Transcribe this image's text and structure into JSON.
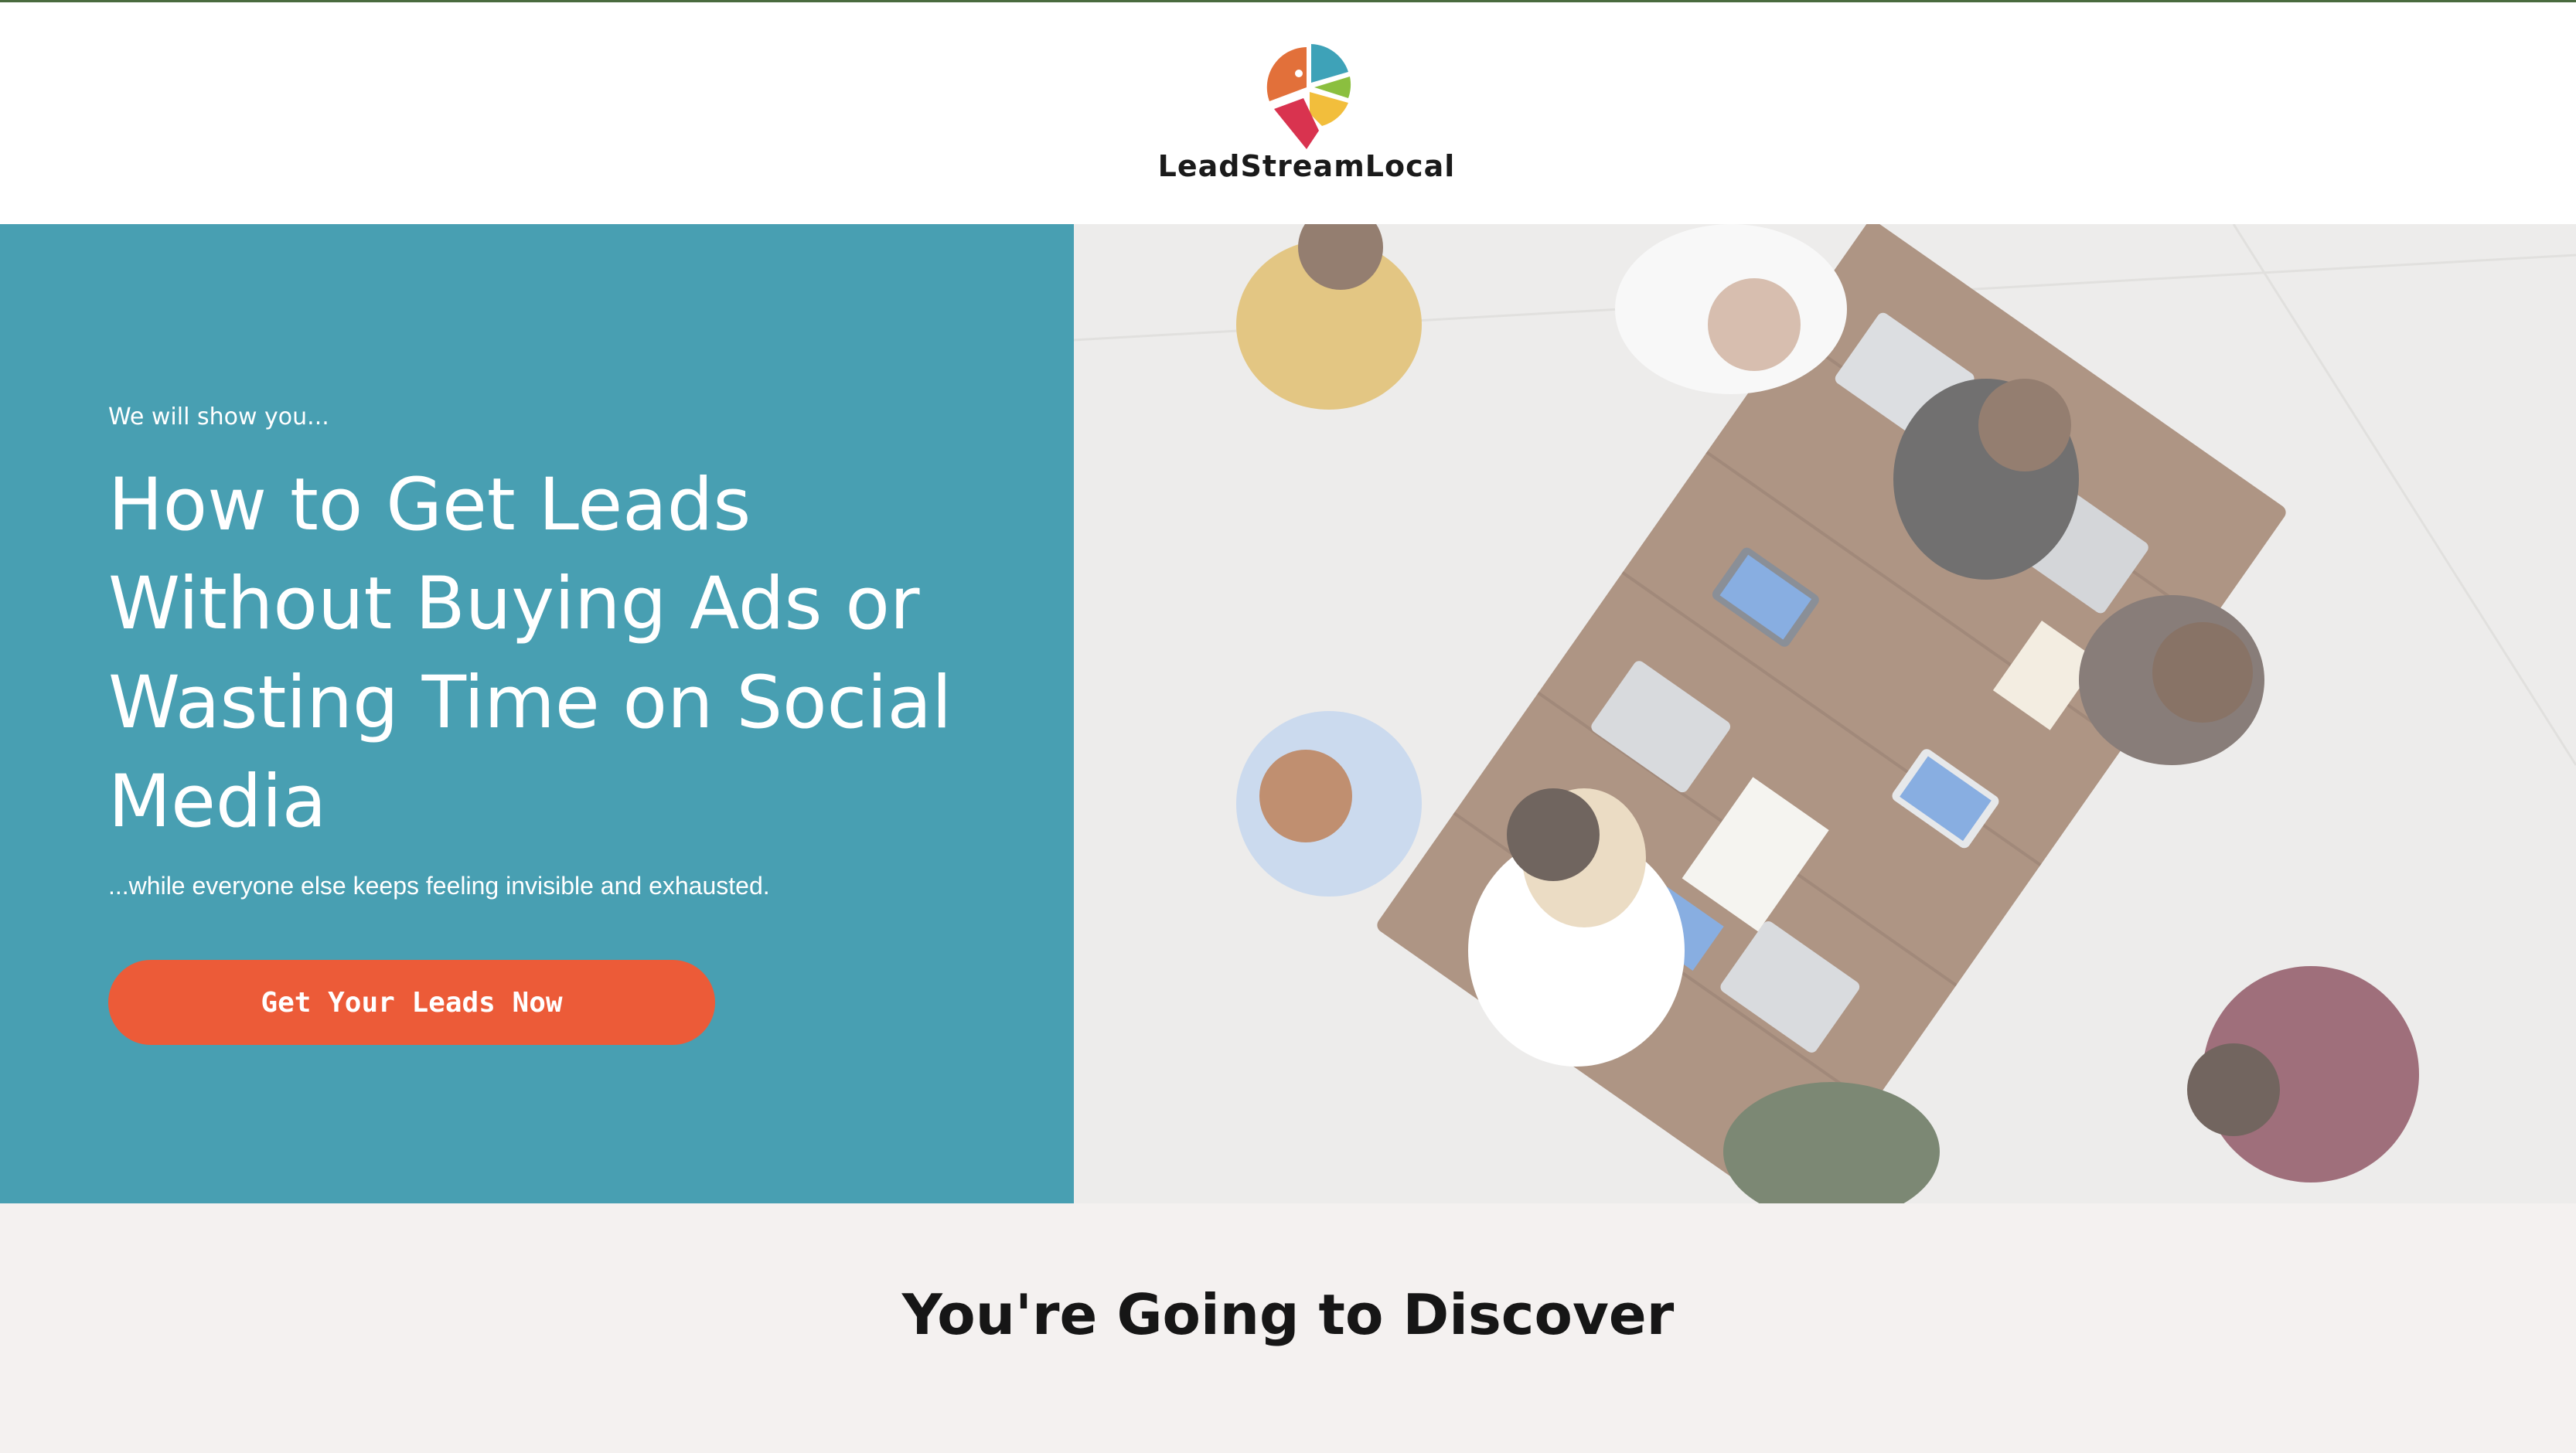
{
  "brand": {
    "name": "LeadStreamLocal",
    "logo_icon": "map-pin-pie-icon",
    "logo_colors": [
      "#e2703a",
      "#3ea2b8",
      "#8bbf3f",
      "#f2be3c",
      "#d9334f"
    ]
  },
  "hero": {
    "eyebrow": "We will show you...",
    "headline": "How to Get Leads Without Buying Ads or Wasting Time on Social Media",
    "subhead": "...while everyone else keeps feeling invisible and exhausted.",
    "cta_label": "Get Your Leads Now",
    "image_subject": "team-meeting-photo",
    "colors": {
      "panel": "#489fb2",
      "cta": "#ec5b38"
    }
  },
  "discover": {
    "title": "You're Going to Discover"
  }
}
